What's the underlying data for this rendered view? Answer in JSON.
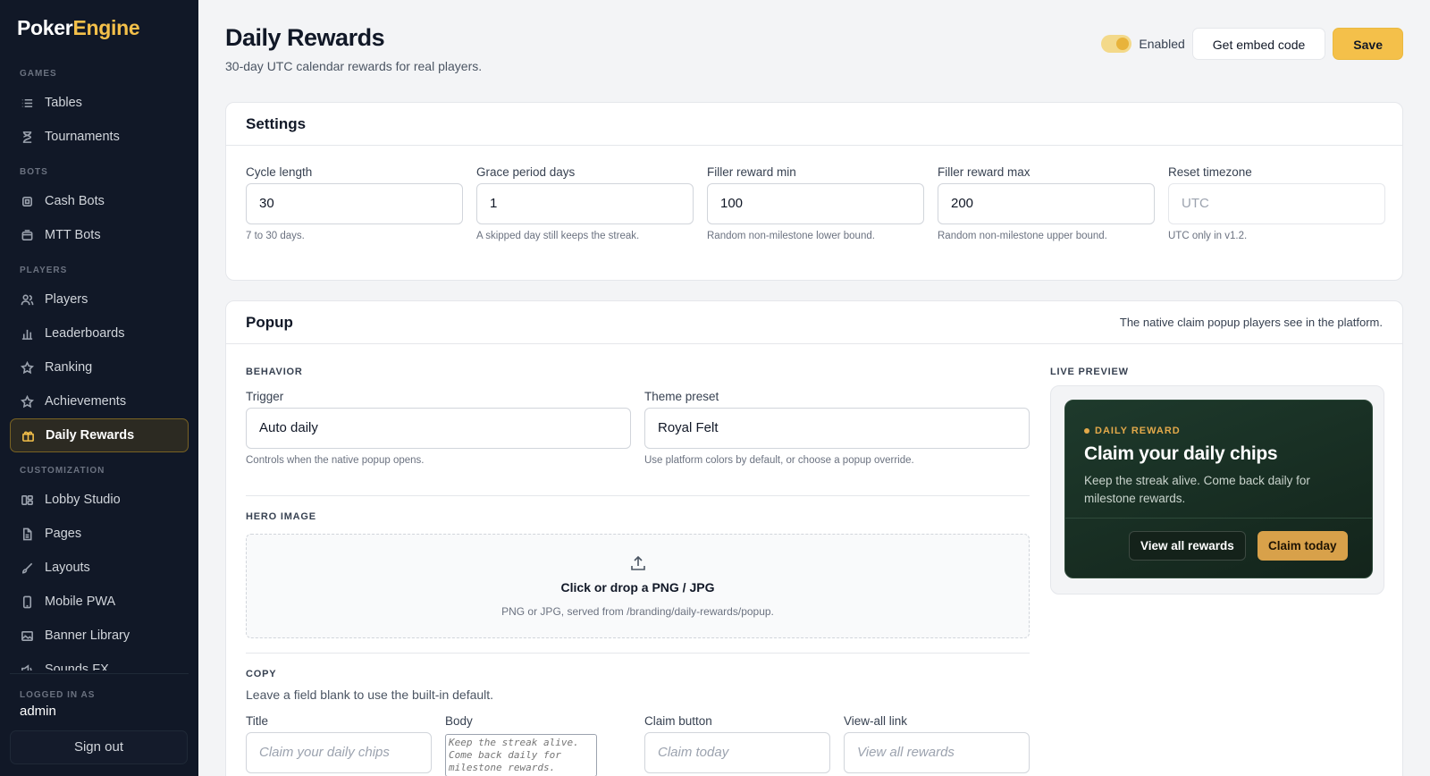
{
  "brand": {
    "part1": "Poker",
    "part2": "Engine",
    "accent": "#f4c04a"
  },
  "sidebar": {
    "sections": [
      {
        "label": "GAMES",
        "items": [
          {
            "label": "Tables",
            "icon": "list-icon"
          },
          {
            "label": "Tournaments",
            "icon": "hourglass-icon"
          }
        ]
      },
      {
        "label": "BOTS",
        "items": [
          {
            "label": "Cash Bots",
            "icon": "cpu-icon"
          },
          {
            "label": "MTT Bots",
            "icon": "box-icon"
          }
        ]
      },
      {
        "label": "PLAYERS",
        "items": [
          {
            "label": "Players",
            "icon": "users-icon"
          },
          {
            "label": "Leaderboards",
            "icon": "bar-chart-icon"
          },
          {
            "label": "Ranking",
            "icon": "star-icon"
          },
          {
            "label": "Achievements",
            "icon": "star-icon"
          },
          {
            "label": "Daily Rewards",
            "icon": "gift-icon",
            "active": true
          }
        ]
      },
      {
        "label": "CUSTOMIZATION",
        "items": [
          {
            "label": "Lobby Studio",
            "icon": "layout-icon"
          },
          {
            "label": "Pages",
            "icon": "file-icon"
          },
          {
            "label": "Layouts",
            "icon": "brush-icon"
          },
          {
            "label": "Mobile PWA",
            "icon": "phone-icon"
          },
          {
            "label": "Banner Library",
            "icon": "image-icon"
          },
          {
            "label": "Sounds FX",
            "icon": "sound-icon"
          }
        ]
      }
    ],
    "logged_in_label": "LOGGED IN AS",
    "user": "admin",
    "signout": "Sign out"
  },
  "header": {
    "title": "Daily Rewards",
    "subtitle": "30-day UTC calendar rewards for real players.",
    "toggle_label": "Enabled",
    "toggle_on": true,
    "embed_button": "Get embed code",
    "save_button": "Save"
  },
  "settings": {
    "title": "Settings",
    "fields": [
      {
        "label": "Cycle length",
        "value": "30",
        "help": "7 to 30 days."
      },
      {
        "label": "Grace period days",
        "value": "1",
        "help": "A skipped day still keeps the streak."
      },
      {
        "label": "Filler reward min",
        "value": "100",
        "help": "Random non-milestone lower bound."
      },
      {
        "label": "Filler reward max",
        "value": "200",
        "help": "Random non-milestone upper bound."
      },
      {
        "label": "Reset timezone",
        "placeholder": "UTC",
        "help": "UTC only in v1.2."
      }
    ]
  },
  "popup": {
    "title": "Popup",
    "note": "The native claim popup players see in the platform.",
    "behavior_label": "BEHAVIOR",
    "trigger": {
      "label": "Trigger",
      "value": "Auto daily",
      "help": "Controls when the native popup opens."
    },
    "theme": {
      "label": "Theme preset",
      "value": "Royal Felt",
      "help": "Use platform colors by default, or choose a popup override."
    },
    "hero_label": "HERO IMAGE",
    "dropzone": {
      "title": "Click or drop a PNG / JPG",
      "help": "PNG or JPG, served from /branding/daily-rewards/popup."
    },
    "copy_label": "COPY",
    "copy_help": "Leave a field blank to use the built-in default.",
    "copy_fields": {
      "title": {
        "label": "Title",
        "placeholder": "Claim your daily chips"
      },
      "body": {
        "label": "Body",
        "placeholder": "Keep the streak alive. Come back daily for milestone rewards."
      },
      "claim": {
        "label": "Claim button",
        "placeholder": "Claim today"
      },
      "view_all": {
        "label": "View-all link",
        "placeholder": "View all rewards"
      }
    },
    "preview_label": "LIVE PREVIEW",
    "preview": {
      "eyebrow": "DAILY REWARD",
      "title": "Claim your daily chips",
      "body": "Keep the streak alive. Come back daily for milestone rewards.",
      "secondary_button": "View all rewards",
      "primary_button": "Claim today"
    }
  }
}
